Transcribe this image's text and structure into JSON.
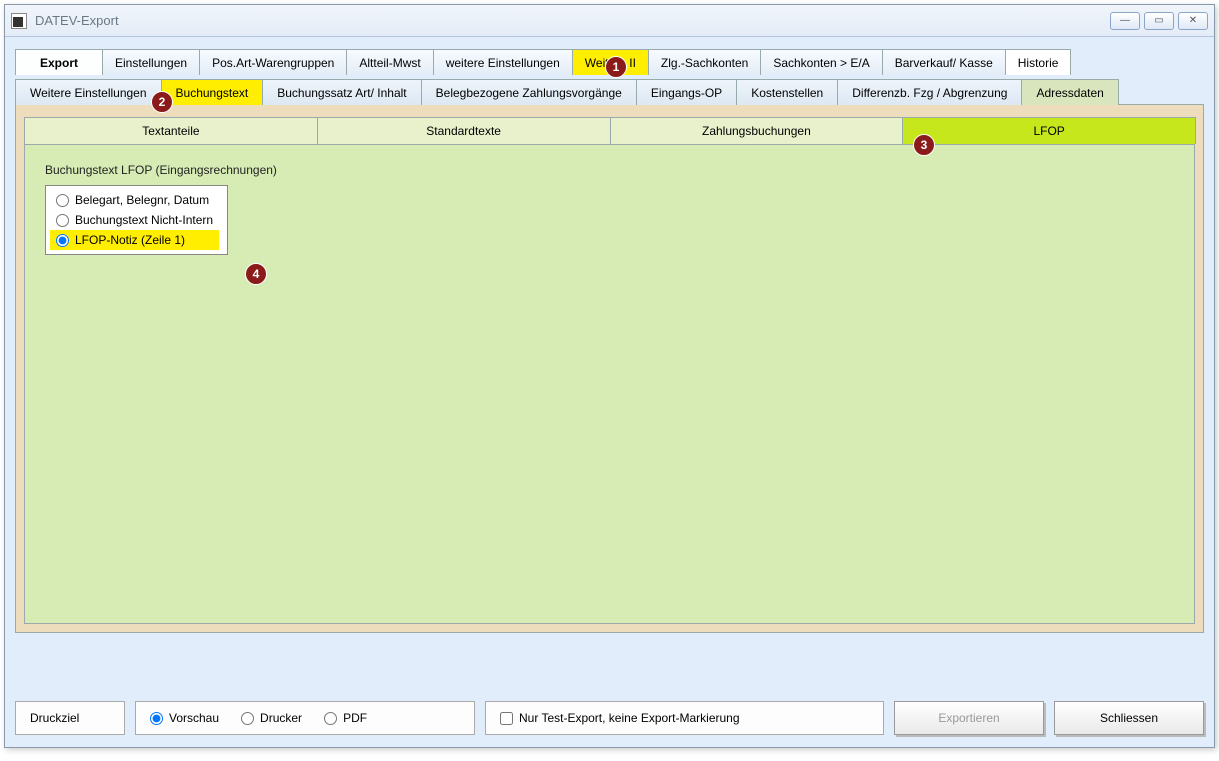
{
  "window": {
    "title": "DATEV-Export"
  },
  "tabs_row1": {
    "export": "Export",
    "einstellungen": "Einstellungen",
    "posart": "Pos.Art-Warengruppen",
    "altteil": "Altteil-Mwst",
    "weitere": "weitere Einstellungen",
    "weitere2": "Weitere II",
    "zlg": "Zlg.-Sachkonten",
    "sachkonten": "Sachkonten > E/A",
    "barverkauf": "Barverkauf/ Kasse",
    "historie": "Historie"
  },
  "tabs_row2": {
    "weitere": "Weitere Einstellungen",
    "buchungstext": "Buchungstext",
    "buchungssatz": "Buchungssatz Art/ Inhalt",
    "beleg": "Belegbezogene Zahlungsvorgänge",
    "eingangsop": "Eingangs-OP",
    "kostenstellen": "Kostenstellen",
    "differenz": "Differenzb. Fzg / Abgrenzung",
    "adress": "Adressdaten"
  },
  "tabs_row3": {
    "textanteile": "Textanteile",
    "standardtexte": "Standardtexte",
    "zahlungsbuchungen": "Zahlungsbuchungen",
    "lfop": "LFOP"
  },
  "group": {
    "title": "Buchungstext LFOP (Eingangsrechnungen)"
  },
  "radios": {
    "r1": "Belegart, Belegnr, Datum",
    "r2": "Buchungstext Nicht-Intern",
    "r3": "LFOP-Notiz (Zeile 1)"
  },
  "bottom": {
    "druckziel": "Druckziel",
    "vorschau": "Vorschau",
    "drucker": "Drucker",
    "pdf": "PDF",
    "test_export": "Nur Test-Export, keine Export-Markierung",
    "exportieren": "Exportieren",
    "schliessen": "Schliessen"
  },
  "badges": {
    "b1": "1",
    "b2": "2",
    "b3": "3",
    "b4": "4"
  }
}
